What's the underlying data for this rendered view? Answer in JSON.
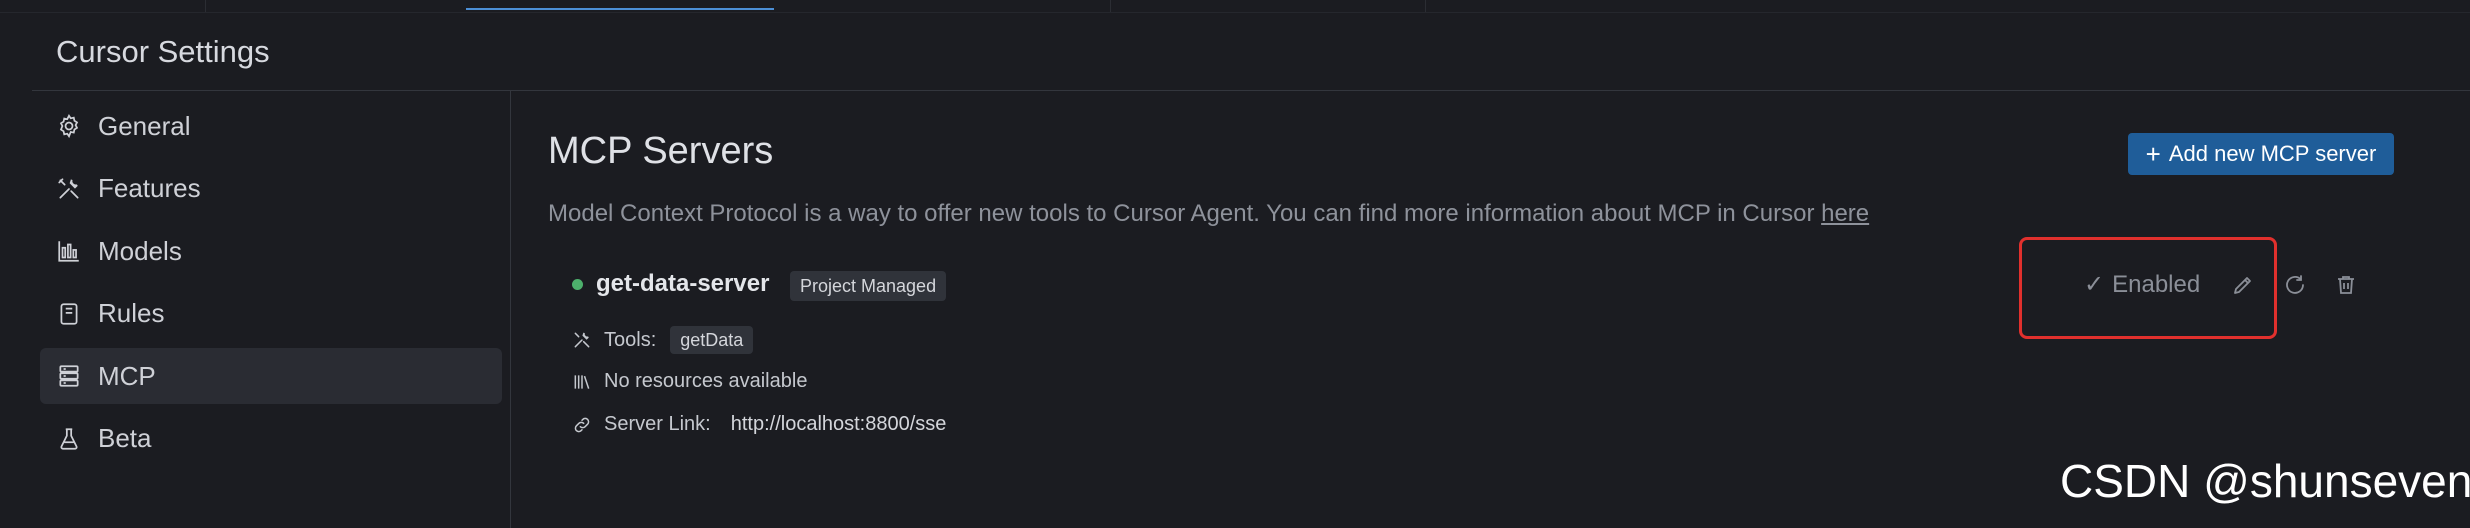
{
  "window": {
    "title": "Cursor Settings"
  },
  "sidebar": {
    "items": [
      {
        "label": "General",
        "icon": "gear-icon"
      },
      {
        "label": "Features",
        "icon": "tools-icon"
      },
      {
        "label": "Models",
        "icon": "bar-chart-icon"
      },
      {
        "label": "Rules",
        "icon": "book-icon"
      },
      {
        "label": "MCP",
        "icon": "server-stack-icon",
        "active": true
      },
      {
        "label": "Beta",
        "icon": "flask-icon"
      }
    ]
  },
  "main": {
    "title": "MCP Servers",
    "add_button_label": "Add new MCP server",
    "description": "Model Context Protocol is a way to offer new tools to Cursor Agent. You can find more information about MCP in Cursor ",
    "description_link": "here",
    "server": {
      "name": "get-data-server",
      "status_color": "#4db06c",
      "badge": "Project Managed",
      "tools_label": "Tools:",
      "tools": [
        "getData"
      ],
      "resources_text": "No resources available",
      "server_link_label": "Server Link:",
      "server_link_value": "http://localhost:8800/sse",
      "enabled_label": "Enabled"
    }
  },
  "colors": {
    "accent": "#1f5d99",
    "highlight": "#e1302d",
    "status_ok": "#4db06c"
  },
  "watermark": "CSDN @shunseven"
}
